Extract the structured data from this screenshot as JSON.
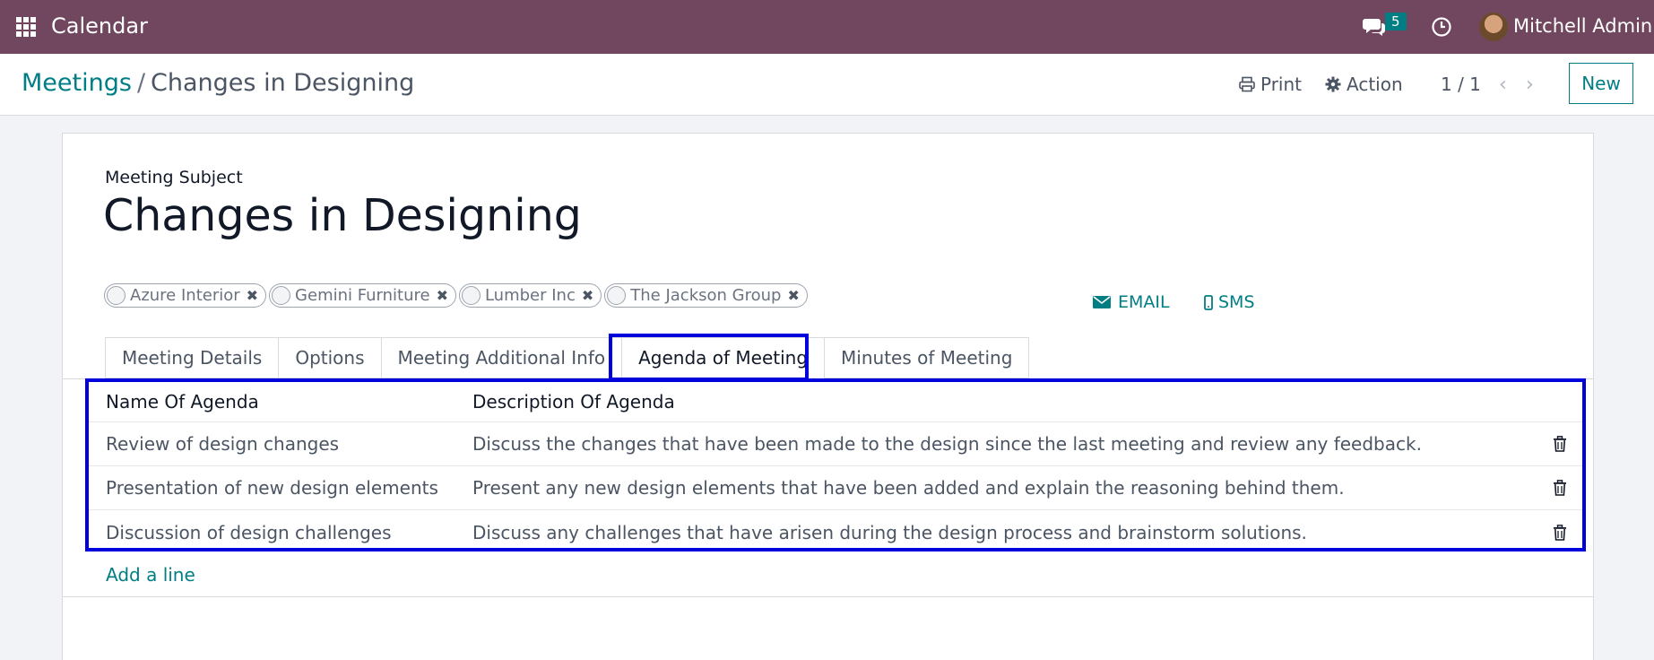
{
  "navbar": {
    "app_title": "Calendar",
    "chat_count": "5",
    "user_name": "Mitchell Admin",
    "bg_color": "#71475f"
  },
  "control_panel": {
    "breadcrumb_parent": "Meetings",
    "breadcrumb_separator": "/",
    "breadcrumb_current": "Changes in Designing",
    "print_label": "Print",
    "action_label": "Action",
    "pager": "1 / 1",
    "new_label": "New"
  },
  "form": {
    "subject_label": "Meeting Subject",
    "subject_value": "Changes in Designing",
    "attendees": [
      {
        "name": "Azure Interior"
      },
      {
        "name": "Gemini Furniture"
      },
      {
        "name": "Lumber Inc"
      },
      {
        "name": "The Jackson Group"
      }
    ],
    "email_label": "EMAIL",
    "sms_label": "SMS",
    "tabs": [
      {
        "label": "Meeting Details"
      },
      {
        "label": "Options"
      },
      {
        "label": "Meeting Additional Info"
      },
      {
        "label": "Agenda of Meeting"
      },
      {
        "label": "Minutes of Meeting"
      }
    ],
    "active_tab": "Agenda of Meeting",
    "agenda": {
      "headers": {
        "name": "Name Of Agenda",
        "description": "Description Of Agenda"
      },
      "rows": [
        {
          "name": "Review of design changes",
          "description": "Discuss the changes that have been made to the design since the last meeting and review any feedback."
        },
        {
          "name": "Presentation of new design elements",
          "description": "Present any new design elements that have been added and explain the reasoning behind them."
        },
        {
          "name": "Discussion of design challenges",
          "description": "Discuss any challenges that have arisen during the design process and brainstorm solutions."
        }
      ],
      "add_line_label": "Add a line"
    }
  },
  "colors": {
    "accent": "#017e84",
    "highlight": "#0000dd"
  },
  "icons": [
    "apps-grid-icon",
    "chat-icon",
    "clock-icon",
    "printer-icon",
    "gear-icon",
    "chevron-left-icon",
    "chevron-right-icon",
    "envelope-icon",
    "mobile-icon",
    "trash-icon",
    "close-icon"
  ]
}
